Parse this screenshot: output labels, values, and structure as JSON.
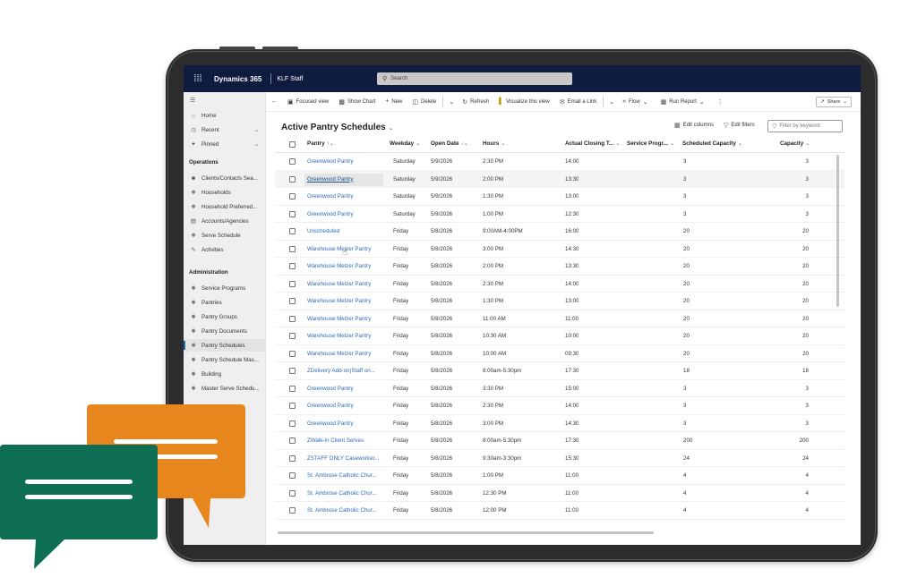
{
  "topbar": {
    "app_name": "Dynamics 365",
    "environment": "KLF Staff",
    "search_placeholder": "Search"
  },
  "sidebar": {
    "items_top": [
      {
        "label": "Home",
        "icon": "home-icon"
      },
      {
        "label": "Recent",
        "icon": "clock-icon"
      },
      {
        "label": "Pinned",
        "icon": "pin-icon"
      }
    ],
    "section_operations": "Operations",
    "operations": [
      {
        "label": "Clients/Contacts Sea..."
      },
      {
        "label": "Households"
      },
      {
        "label": "Household Preferred..."
      },
      {
        "label": "Accounts/Agencies"
      },
      {
        "label": "Serve Schedule"
      },
      {
        "label": "Activities"
      }
    ],
    "section_administration": "Administration",
    "administration": [
      {
        "label": "Service Programs"
      },
      {
        "label": "Pantries"
      },
      {
        "label": "Pantry Groups"
      },
      {
        "label": "Pantry Documents"
      },
      {
        "label": "Pantry Schedules"
      },
      {
        "label": "Pantry Schedule Mas..."
      },
      {
        "label": "Building"
      },
      {
        "label": "Master Serve Schedu..."
      }
    ]
  },
  "commands": {
    "focused_view": "Focused view",
    "show_chart": "Show Chart",
    "new": "New",
    "delete": "Delete",
    "refresh": "Refresh",
    "visualize": "Visualize this view",
    "email_link": "Email a Link",
    "flow": "Flow",
    "run_report": "Run Report",
    "share": "Share"
  },
  "view": {
    "title": "Active Pantry Schedules",
    "edit_columns": "Edit columns",
    "edit_filters": "Edit filters",
    "filter_placeholder": "Filter by keyword"
  },
  "grid": {
    "headers": {
      "pantry": "Pantry",
      "weekday": "Weekday",
      "open_date": "Open Date",
      "hours": "Hours",
      "actual_closing": "Actual Closing T...",
      "service_prog": "Service Progr...",
      "scheduled_capacity": "Scheduled Capacity",
      "capacity": "Capacity"
    },
    "rows": [
      [
        "Greenwood Pantry",
        "Saturday",
        "5/9/2026",
        "2:30 PM",
        "14:00",
        "",
        "3",
        "3"
      ],
      [
        "Greenwood Pantry",
        "Saturday",
        "5/9/2026",
        "2:00 PM",
        "13:30",
        "",
        "3",
        "3"
      ],
      [
        "Greenwood Pantry",
        "Saturday",
        "5/9/2026",
        "1:30 PM",
        "13:00",
        "",
        "3",
        "3"
      ],
      [
        "Greenwood Pantry",
        "Saturday",
        "5/9/2026",
        "1:00 PM",
        "12:30",
        "",
        "3",
        "3"
      ],
      [
        "Unscheduled",
        "Friday",
        "5/8/2026",
        "9:00AM-4:00PM",
        "16:00",
        "",
        "20",
        "20"
      ],
      [
        "Warehouse Melzer Pantry",
        "Friday",
        "5/8/2026",
        "3:00 PM",
        "14:30",
        "",
        "20",
        "20"
      ],
      [
        "Warehouse Melzer Pantry",
        "Friday",
        "5/8/2026",
        "2:00 PM",
        "13:30",
        "",
        "20",
        "20"
      ],
      [
        "Warehouse Melzer Pantry",
        "Friday",
        "5/8/2026",
        "2:30 PM",
        "14:00",
        "",
        "20",
        "20"
      ],
      [
        "Warehouse Melzer Pantry",
        "Friday",
        "5/8/2026",
        "1:30 PM",
        "13:00",
        "",
        "20",
        "20"
      ],
      [
        "Warehouse Melzer Pantry",
        "Friday",
        "5/8/2026",
        "11:00 AM",
        "11:00",
        "",
        "20",
        "20"
      ],
      [
        "Warehouse Melzer Pantry",
        "Friday",
        "5/8/2026",
        "10:30 AM",
        "10:00",
        "",
        "20",
        "20"
      ],
      [
        "Warehouse Melzer Pantry",
        "Friday",
        "5/8/2026",
        "10:00 AM",
        "09:30",
        "",
        "20",
        "20"
      ],
      [
        "ZDelivery Add-on(Staff on...",
        "Friday",
        "5/8/2026",
        "8:00am-5:30pm",
        "17:30",
        "",
        "18",
        "18"
      ],
      [
        "Greenwood Pantry",
        "Friday",
        "5/8/2026",
        "3:30 PM",
        "15:00",
        "",
        "3",
        "3"
      ],
      [
        "Greenwood Pantry",
        "Friday",
        "5/8/2026",
        "2:30 PM",
        "14:00",
        "",
        "3",
        "3"
      ],
      [
        "Greenwood Pantry",
        "Friday",
        "5/8/2026",
        "3:00 PM",
        "14:30",
        "",
        "3",
        "3"
      ],
      [
        "ZWalk-In Client Serves",
        "Friday",
        "5/8/2026",
        "8:00am-5:30pm",
        "17:30",
        "",
        "200",
        "200"
      ],
      [
        "ZSTAFF ONLY Caseworker...",
        "Friday",
        "5/8/2026",
        "9:30am-3:30pm",
        "15:30",
        "",
        "24",
        "24"
      ],
      [
        "St. Ambrose Catholic Chur...",
        "Friday",
        "5/8/2026",
        "1:00 PM",
        "11:00",
        "",
        "4",
        "4"
      ],
      [
        "St. Ambrose Catholic Chur...",
        "Friday",
        "5/8/2026",
        "12:30 PM",
        "11:00",
        "",
        "4",
        "4"
      ],
      [
        "St. Ambrose Catholic Chur...",
        "Friday",
        "5/8/2026",
        "12:00 PM",
        "11:00",
        "",
        "4",
        "4"
      ]
    ]
  }
}
